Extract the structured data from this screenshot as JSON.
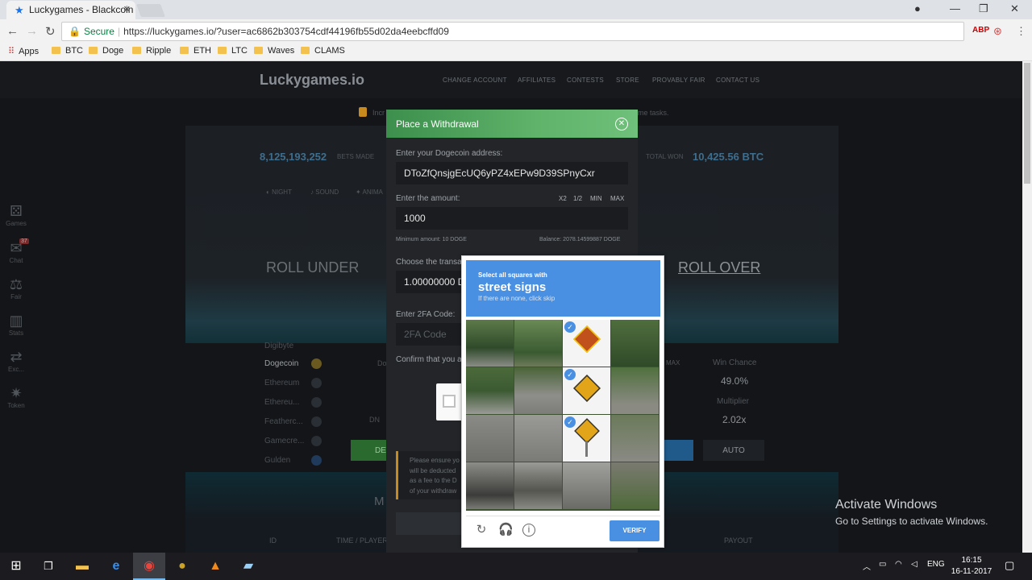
{
  "browser": {
    "tab_title": "Luckygames - Blackcoin",
    "secure_label": "Secure",
    "url": "https://luckygames.io/?user=ac6862b303754cdf44196fb55d02da4eebcffd09",
    "bookmarks": [
      "Apps",
      "BTC",
      "Doge",
      "Ripple",
      "ETH",
      "LTC",
      "Waves",
      "CLAMS"
    ]
  },
  "site": {
    "logo": "Luckygames.io",
    "nav": [
      "CHANGE ACCOUNT",
      "AFFILIATES",
      "CONTESTS",
      "STORE",
      "PROVABLY FAIR",
      "CONTACT US"
    ],
    "notice": "Incr",
    "notice_tail": "me tasks.",
    "bets_made_value": "8,125,193,252",
    "bets_made_label": "BETS MADE",
    "total_won_label": "TOTAL WON",
    "total_won_value": "10,425.56 BTC",
    "options": [
      "NIGHT",
      "SOUND",
      "ANIMA"
    ],
    "roll_under": "ROLL UNDER",
    "roll_over": "ROLL OVER",
    "sidebar": [
      {
        "label": "Games",
        "icon": "dice-icon"
      },
      {
        "label": "Chat",
        "icon": "chat-icon",
        "badge": "37"
      },
      {
        "label": "Fair",
        "icon": "scale-icon"
      },
      {
        "label": "Stats",
        "icon": "stats-icon"
      },
      {
        "label": "Exc...",
        "icon": "exchange-icon"
      },
      {
        "label": "Token",
        "icon": "token-icon"
      }
    ],
    "coins": [
      "Digibyte",
      "Dogecoin",
      "Ethereum",
      "Ethereu...",
      "Featherc...",
      "Gamecre...",
      "Gulden"
    ],
    "selected_coin": "Dogecoin",
    "max_label": "MAX",
    "win_chance_label": "Win Chance",
    "win_chance_value": "49.0%",
    "multiplier_label": "Multiplier",
    "multiplier_value": "2.02x",
    "auto_label": "AUTO",
    "partial_left_1": "Do",
    "partial_left_2": "DN",
    "partial_green": "DE",
    "bottom_partial": "M",
    "table_headers": [
      "ID",
      "TIME / PLAYER",
      "PAYOUT"
    ]
  },
  "modal": {
    "title": "Place a Withdrawal",
    "address_label": "Enter your Dogecoin address:",
    "address_value": "DToZfQnsjgEcUQ6yPZ4xEPw9D39SPnyCxr",
    "amount_label": "Enter the amount:",
    "amount_value": "1000",
    "quick": [
      "X2",
      "1/2",
      "MIN",
      "MAX"
    ],
    "min_amount": "Minimum amount: 10 DOGE",
    "balance": "Balance: 2078.14599887 DOGE",
    "fee_label": "Choose the transa",
    "fee_value": "1.00000000 D",
    "twofa_label": "Enter 2FA Code:",
    "twofa_placeholder": "2FA Code",
    "confirm_label": "Confirm that you a",
    "note_lines": [
      "Please ensure yo",
      "will be deducted",
      "as a fee to the D",
      "of your withdraw"
    ]
  },
  "captcha": {
    "instruction": "Select all squares with",
    "target": "street signs",
    "hint": "If there are none, click skip",
    "verify": "VERIFY",
    "icons": [
      "reload-icon",
      "audio-icon",
      "info-icon"
    ]
  },
  "desktop": {
    "activate_title": "Activate Windows",
    "activate_sub": "Go to Settings to activate Windows.",
    "language": "ENG",
    "time": "16:15",
    "date": "16-11-2017"
  }
}
